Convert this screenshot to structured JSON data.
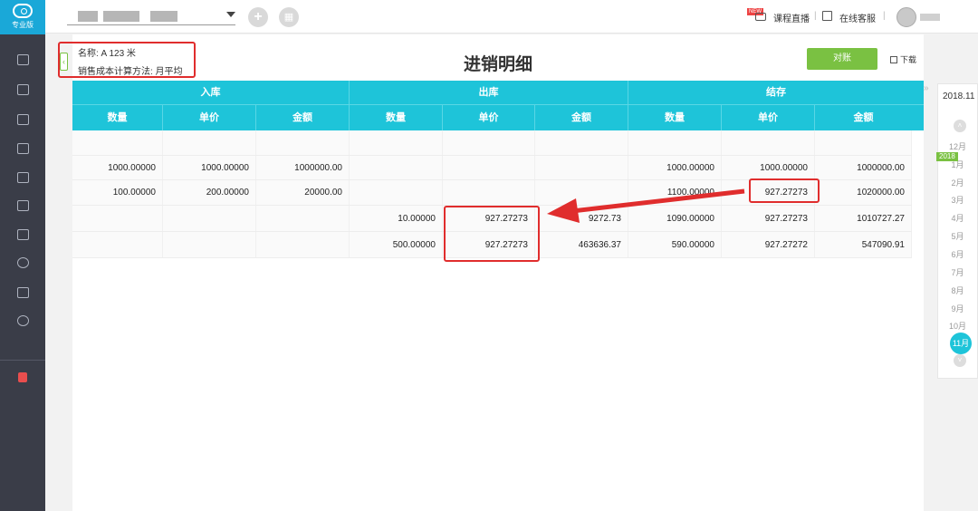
{
  "sidebar": {
    "logo_text": "专业版",
    "items": [
      "voucher-icon",
      "ledger-icon",
      "report-icon",
      "asset-icon",
      "invoice-icon",
      "cashier-icon",
      "salary-icon",
      "stock-icon",
      "query-icon",
      "settings-icon"
    ],
    "bottom_item": "recycle-icon"
  },
  "topbar": {
    "company": "",
    "course_live": "课程直播",
    "new_badge": "NEW",
    "online_service": "在线客服"
  },
  "info": {
    "name": "名称: A 123 米",
    "cost_method": "销售成本计算方法: 月平均"
  },
  "page_title": "进销明细",
  "actions": {
    "reconcile": "对账",
    "download": "下载"
  },
  "table": {
    "groups": [
      "入库",
      "出库",
      "结存"
    ],
    "subheaders": [
      "数量",
      "单价",
      "金额",
      "数量",
      "单价",
      "金额",
      "数量",
      "单价",
      "金额"
    ],
    "rows": [
      [
        "",
        "",
        "",
        "",
        "",
        "",
        "",
        "",
        ""
      ],
      [
        "1000.00000",
        "1000.00000",
        "1000000.00",
        "",
        "",
        "",
        "1000.00000",
        "1000.00000",
        "1000000.00"
      ],
      [
        "100.00000",
        "200.00000",
        "20000.00",
        "",
        "",
        "",
        "1100.00000",
        "927.27273",
        "1020000.00"
      ],
      [
        "",
        "",
        "",
        "10.00000",
        "927.27273",
        "9272.73",
        "1090.00000",
        "927.27273",
        "1010727.27"
      ],
      [
        "",
        "",
        "",
        "500.00000",
        "927.27273",
        "463636.37",
        "590.00000",
        "927.27272",
        "547090.91"
      ]
    ]
  },
  "month_picker": {
    "current": "2018.11",
    "year_badge": "2018",
    "months": [
      "12月",
      "1月",
      "2月",
      "3月",
      "4月",
      "5月",
      "6月",
      "7月",
      "8月",
      "9月",
      "10月"
    ],
    "active": "11月",
    "colors": {
      "accent": "#1ec4d9",
      "green": "#7ac142",
      "highlight": "#e02d2d"
    }
  }
}
